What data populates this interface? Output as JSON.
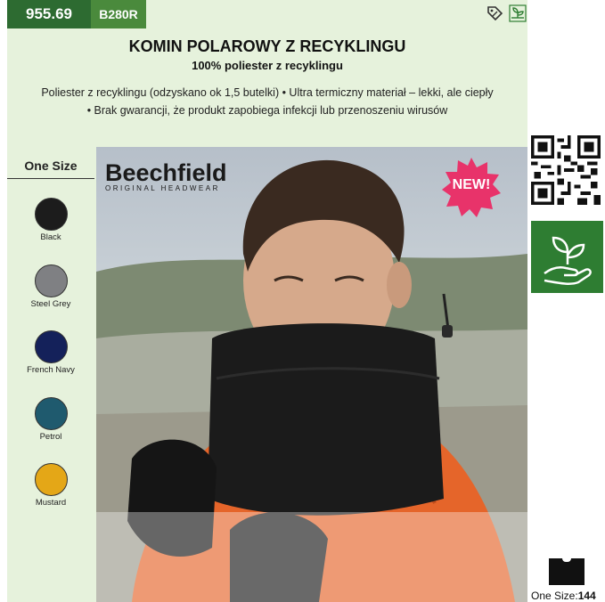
{
  "header": {
    "price": "955.69",
    "code": "B280R"
  },
  "product": {
    "title": "KOMIN POLAROWY Z RECYKLINGU",
    "subtitle": "100% poliester z recyklingu",
    "desc_line1": "Poliester z recyklingu (odzyskano ok 1,5 butelki) • Ultra termiczny materiał – lekki, ale ciepły",
    "desc_line2": "• Brak gwarancji, że produkt zapobiega infekcji lub przenoszeniu wirusów"
  },
  "sizes": {
    "heading": "One Size"
  },
  "colors": [
    {
      "name": "Black",
      "hex": "#1c1c1c"
    },
    {
      "name": "Steel Grey",
      "hex": "#7f8083"
    },
    {
      "name": "French Navy",
      "hex": "#14215a"
    },
    {
      "name": "Petrol",
      "hex": "#1f5a6e"
    },
    {
      "name": "Mustard",
      "hex": "#e4a717"
    }
  ],
  "photo": {
    "brand_name": "Beechfield",
    "brand_tagline": "ORIGINAL HEADWEAR",
    "badge": "NEW!"
  },
  "side": {
    "size_label": "One Size:",
    "size_value": "144"
  },
  "icons": {
    "discount": "percent-tag-icon",
    "eco_small": "plant-icon",
    "eco_large": "plant-hand-icon",
    "qr": "qr-code-icon"
  },
  "accent": {
    "dark_green": "#2d6b31",
    "green": "#4a8a3c",
    "badge_pink": "#e8336a",
    "panel": "#e6f2dc"
  }
}
